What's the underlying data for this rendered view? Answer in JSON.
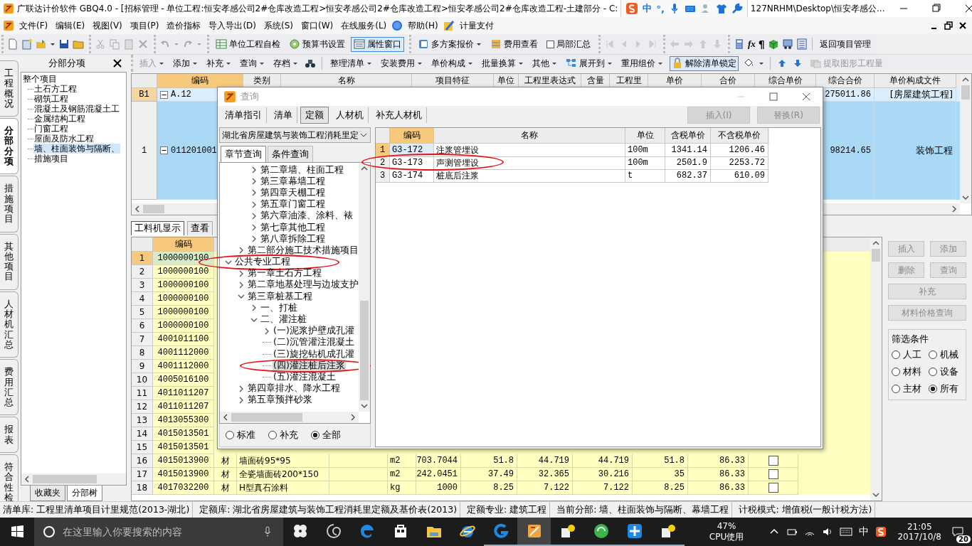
{
  "window": {
    "title_left": "广联达计价软件 GBQ4.0 - [招标管理 - 单位工程:恒安孝感公司2#仓库改造工程>恒安孝感公司2#仓库改造工程>恒安孝感公司2#仓库改造工程-土建部分 - C:",
    "title_right": "127NRHM\\Desktop\\恒安孝感公..."
  },
  "ime_bar": {
    "mode": "中",
    "punct": "°,"
  },
  "menu": [
    {
      "label": "文件(F)",
      "kind": "text"
    },
    {
      "label": "编辑(E)",
      "kind": "text"
    },
    {
      "label": "视图(V)",
      "kind": "text"
    },
    {
      "label": "项目(P)",
      "kind": "text"
    },
    {
      "label": "造价指标",
      "kind": "text"
    },
    {
      "label": "导入导出(D)",
      "kind": "text"
    },
    {
      "label": "系统(S)",
      "kind": "text"
    },
    {
      "label": "窗口(W)",
      "kind": "text"
    },
    {
      "label": "在线服务(L)",
      "kind": "text"
    },
    {
      "label": "帮助(H)",
      "kind": "help"
    },
    {
      "label": "计量支付",
      "kind": "pay"
    }
  ],
  "toolbar1": {
    "self_check": "单位工程自检",
    "budget_settings": "预算书设置",
    "property_window": {
      "label": "属性窗口",
      "pressed": true
    },
    "multi_quote": "多方案报价",
    "cost_view": "费用查看",
    "partial_sum": {
      "label": "局部汇总",
      "checked": false
    },
    "formula": "fx",
    "pilcrow": "¶",
    "back": "返回项目管理"
  },
  "toolbar2": {
    "group1": [
      {
        "label": "插入",
        "dropdown": true,
        "disabled": true
      },
      {
        "label": "添加",
        "dropdown": true,
        "disabled": false
      },
      {
        "label": "补充",
        "dropdown": true,
        "disabled": false
      },
      {
        "label": "查询",
        "dropdown": true,
        "disabled": false
      },
      {
        "label": "存档",
        "dropdown": true,
        "disabled": false
      }
    ],
    "group2": [
      {
        "label": "整理清单",
        "dropdown": true,
        "disabled": false
      },
      {
        "label": "安装费用",
        "dropdown": true,
        "disabled": false
      },
      {
        "label": "单价构成",
        "dropdown": true,
        "disabled": false
      },
      {
        "label": "批量换算",
        "dropdown": true,
        "disabled": false
      },
      {
        "label": "其他",
        "dropdown": true,
        "disabled": false
      },
      {
        "label": "展开到",
        "dropdown": true,
        "disabled": false,
        "has_icon": true
      },
      {
        "label": "重用组价",
        "dropdown": true,
        "disabled": false
      }
    ],
    "unlock": "解除清单锁定",
    "extract": {
      "label": "提取图形工程量",
      "disabled": true
    }
  },
  "left_tabs": [
    {
      "label": "工程概况",
      "selected": false
    },
    {
      "label": "分部分项",
      "selected": true
    },
    {
      "label": "措施项目",
      "selected": false
    },
    {
      "label": "其他项目",
      "selected": false
    },
    {
      "label": "人材机汇总",
      "selected": false
    },
    {
      "label": "费用汇总",
      "selected": false
    },
    {
      "label": "报表",
      "selected": false
    },
    {
      "label": "符合性检",
      "selected": false
    }
  ],
  "side_panel": {
    "title": "分部分项",
    "tree": {
      "label": "整个项目",
      "selected": false,
      "children": [
        {
          "label": "土石方工程",
          "selected": false
        },
        {
          "label": "砌筑工程",
          "selected": false
        },
        {
          "label": "混凝土及钢筋混凝土工",
          "selected": false
        },
        {
          "label": "金属结构工程",
          "selected": false
        },
        {
          "label": "门窗工程",
          "selected": false
        },
        {
          "label": "屋面及防水工程",
          "selected": false
        },
        {
          "label": "墙、柱面装饰与隔断、",
          "selected": true
        },
        {
          "label": "措施项目",
          "selected": false
        }
      ]
    },
    "bottom_tabs": [
      {
        "label": "收藏夹",
        "selected": false
      },
      {
        "label": "分部树",
        "selected": true
      }
    ]
  },
  "upper_grid": {
    "columns": [
      "编码",
      "类别",
      "名称",
      "项目特征",
      "单位",
      "工程里表达式",
      "含量",
      "工程里",
      "单价",
      "合价",
      "综合单价",
      "综合合价",
      "单价构成文件"
    ],
    "rows": [
      {
        "header": "B1",
        "code": "A.12",
        "expanded": true,
        "total": "275011.86",
        "file": "[房屋建筑工程]"
      },
      {
        "header": "1",
        "code": "011201001",
        "expanded": true,
        "total": "98214.65",
        "file": "装饰工程"
      }
    ]
  },
  "lower_tabs": [
    {
      "label": "工料机显示",
      "selected": true
    },
    {
      "label": "查看",
      "selected": false
    }
  ],
  "lower_grid": {
    "columns": [
      "编码"
    ],
    "rows": [
      {
        "n": "1",
        "code": "1000000100",
        "selected": true
      },
      {
        "n": "2",
        "code": "1000000100",
        "selected": false
      },
      {
        "n": "3",
        "code": "1000000100",
        "selected": false
      },
      {
        "n": "4",
        "code": "1000000100",
        "selected": false
      },
      {
        "n": "5",
        "code": "1000000100",
        "selected": false
      },
      {
        "n": "6",
        "code": "1000000100",
        "selected": false
      },
      {
        "n": "7",
        "code": "4001011100",
        "selected": false
      },
      {
        "n": "8",
        "code": "4001112000",
        "selected": false
      },
      {
        "n": "9",
        "code": "4001112000",
        "selected": false
      },
      {
        "n": "10",
        "code": "4005016100",
        "selected": false
      },
      {
        "n": "11",
        "code": "4011011207",
        "selected": false
      },
      {
        "n": "12",
        "code": "4011011207",
        "selected": false
      },
      {
        "n": "13",
        "code": "4013055300",
        "selected": false
      },
      {
        "n": "14",
        "code": "4015013501",
        "selected": false
      },
      {
        "n": "15",
        "code": "4015013501",
        "selected": false
      },
      {
        "n": "16",
        "code": "4015013900",
        "selected": false,
        "type": "材",
        "name": "墙面砖95*95",
        "unit": "m2",
        "values": [
          "703.7044",
          "51.8",
          "44.719",
          "44.719",
          "51.8",
          "86.33"
        ],
        "checked": false
      },
      {
        "n": "17",
        "code": "4015013900",
        "selected": false,
        "type": "材",
        "name": "全瓷墙面砖200*150",
        "unit": "m2",
        "values": [
          "242.0451",
          "37.49",
          "32.365",
          "30.216",
          "35",
          "86.33"
        ],
        "checked": false
      },
      {
        "n": "18",
        "code": "4017032200",
        "selected": false,
        "type": "材",
        "name": "H型真石涂料",
        "unit": "kg",
        "values": [
          "1000",
          "8.25",
          "7.122",
          "7.122",
          "8.25",
          "86.33"
        ],
        "checked": false
      }
    ]
  },
  "right_panel": {
    "buttons": [
      {
        "label": "插入",
        "disabled": true,
        "wide": false
      },
      {
        "label": "添加",
        "disabled": true,
        "wide": false
      },
      {
        "label": "删除",
        "disabled": true,
        "wide": false
      },
      {
        "label": "查询",
        "disabled": true,
        "wide": false
      },
      {
        "label": "补充",
        "disabled": true,
        "wide": true
      },
      {
        "label": "材料价格查询",
        "disabled": true,
        "wide": true
      }
    ],
    "filter": {
      "title": "筛选条件",
      "options": [
        {
          "label": "人工",
          "selected": false
        },
        {
          "label": "机械",
          "selected": false
        },
        {
          "label": "材料",
          "selected": false
        },
        {
          "label": "设备",
          "selected": false
        },
        {
          "label": "主材",
          "selected": false
        },
        {
          "label": "所有",
          "selected": true
        }
      ]
    }
  },
  "dialog": {
    "title": "查询",
    "tabs": [
      {
        "label": "清单指引",
        "selected": false
      },
      {
        "label": "清单",
        "selected": false
      },
      {
        "label": "定额",
        "selected": true
      },
      {
        "label": "人材机",
        "selected": false
      },
      {
        "label": "补充人材机",
        "selected": false
      }
    ],
    "insert": {
      "label": "插入(I)",
      "disabled": true
    },
    "replace": {
      "label": "替换(R)",
      "disabled": true
    },
    "library": "湖北省房屋建筑与装饰工程消耗里定",
    "subtabs": [
      {
        "label": "章节查询",
        "selected": true
      },
      {
        "label": "条件查询",
        "selected": false
      }
    ],
    "tree": [
      {
        "children": [
          {
            "children": [
              {
                "label": "第二章墙、柱面工程",
                "expanded": false
              },
              {
                "label": "第三章幕墙工程",
                "expanded": false
              },
              {
                "label": "第四章天棚工程",
                "expanded": false
              },
              {
                "label": "第五章门窗工程",
                "expanded": false
              },
              {
                "label": "第六章油漆、涂料、裱",
                "expanded": false
              },
              {
                "label": "第七章其他工程",
                "expanded": false
              },
              {
                "label": "第八章拆除工程",
                "expanded": false
              }
            ]
          },
          {
            "label": "第二部分施工技术措施项目",
            "expanded": false
          }
        ]
      },
      {
        "label": "公共专业工程",
        "expanded": true,
        "circled": true,
        "children": [
          {
            "label": "第一章土石方工程",
            "expanded": false
          },
          {
            "label": "第二章地基处理与边坡支护",
            "expanded": false
          },
          {
            "label": "第三章桩基工程",
            "expanded": true,
            "children": [
              {
                "label": "一、打桩",
                "expanded": false
              },
              {
                "label": "二、灌注桩",
                "expanded": true,
                "children": [
                  {
                    "label": "(一)泥浆护壁成孔灌",
                    "expanded": false
                  },
                  {
                    "label": "(二)沉管灌注混凝土"
                  },
                  {
                    "label": "(三)旋挖钻机成孔灌"
                  },
                  {
                    "label": "(四)灌注桩后注浆",
                    "selected": true,
                    "circled": true
                  },
                  {
                    "label": "(五)灌注混凝土"
                  }
                ]
              }
            ]
          },
          {
            "label": "第四章排水、降水工程",
            "expanded": false
          },
          {
            "label": "第五章预拌砂浆",
            "expanded": false
          }
        ]
      }
    ],
    "scope": [
      {
        "label": "标准",
        "selected": false
      },
      {
        "label": "补充",
        "selected": false
      },
      {
        "label": "全部",
        "selected": true
      }
    ],
    "table": {
      "columns": [
        "编码",
        "名称",
        "单位",
        "含税单价",
        "不含税单价"
      ],
      "rows": [
        {
          "n": "1",
          "code": "G3-172",
          "name": "注浆管埋设",
          "unit": "100m",
          "tax_price": "1341.14",
          "net_price": "1206.46",
          "selected": true,
          "circled": false
        },
        {
          "n": "2",
          "code": "G3-173",
          "name": "声测管埋设",
          "unit": "100m",
          "tax_price": "2501.9",
          "net_price": "2253.72",
          "selected": false,
          "circled": true
        },
        {
          "n": "3",
          "code": "G3-174",
          "name": "桩底后注浆",
          "unit": "t",
          "tax_price": "682.37",
          "net_price": "610.09",
          "selected": false,
          "circled": false
        }
      ]
    }
  },
  "status_bar": [
    "清单库: 工程里清单项目计里规范(2013-湖北)",
    "定额库: 湖北省房屋建筑与装饰工程消耗里定额及基价表(2013)",
    "定额专业: 建筑工程",
    "当前分部: 墙、柱面装饰与隔断、幕墙工程",
    "计税模式: 增值税(一般计税方法)"
  ],
  "taskbar": {
    "search": {
      "placeholder": "在这里输入你要搜索的内容"
    },
    "apps": [
      {
        "kind": "fan",
        "running": false,
        "active": false
      },
      {
        "kind": "swirl",
        "running": false,
        "active": false
      },
      {
        "kind": "edge",
        "running": false,
        "active": false
      },
      {
        "kind": "store",
        "running": false,
        "active": false
      },
      {
        "kind": "folder",
        "running": false,
        "active": false
      },
      {
        "kind": "ie",
        "running": false,
        "active": false
      },
      {
        "kind": "g",
        "running": true,
        "active": false
      },
      {
        "kind": "notepad",
        "running": true,
        "active": true
      },
      {
        "kind": "help",
        "running": true,
        "active": false
      },
      {
        "kind": "refresh",
        "running": true,
        "active": false
      },
      {
        "kind": "pin",
        "running": true,
        "active": false
      },
      {
        "kind": "help",
        "running": true,
        "active": false
      }
    ],
    "cpu": {
      "value": "47%",
      "label": "CPU使用"
    },
    "ime": "中",
    "time": "21:05",
    "date": "2017/10/8",
    "notifications": "20"
  }
}
